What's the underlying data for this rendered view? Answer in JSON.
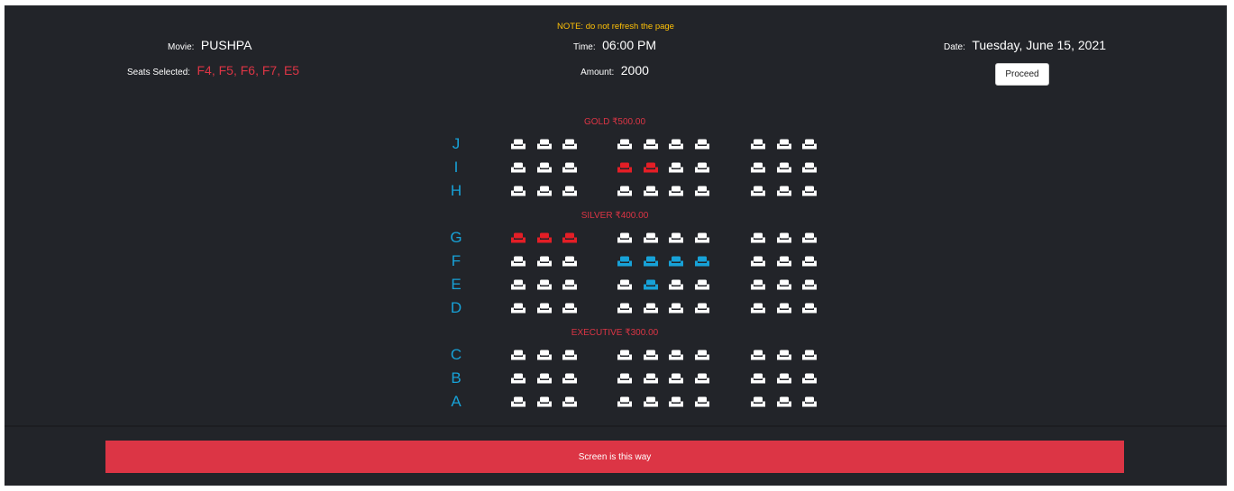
{
  "header": {
    "note": "NOTE: do not refresh the page",
    "movie": {
      "label": "Movie:",
      "value": "PUSHPA"
    },
    "seats": {
      "label": "Seats Selected:",
      "value": "F4, F5, F6, F7, E5"
    },
    "time": {
      "label": "Time:",
      "value": "06:00 PM"
    },
    "amount": {
      "label": "Amount:",
      "value": "2000"
    },
    "date": {
      "label": "Date:",
      "value": "Tuesday, June 15, 2021"
    },
    "proceed_label": "Proceed"
  },
  "colors": {
    "available": "#ffffff",
    "booked": "#e41e26",
    "selected": "#17a2d8"
  },
  "tiers": [
    {
      "label": "GOLD ₹500.00",
      "rows": [
        {
          "label": "J",
          "seats": [
            "a",
            "a",
            "a",
            "a",
            "a",
            "a",
            "a",
            "a",
            "a",
            "a"
          ]
        },
        {
          "label": "I",
          "seats": [
            "a",
            "a",
            "a",
            "b",
            "b",
            "a",
            "a",
            "a",
            "a",
            "a"
          ]
        },
        {
          "label": "H",
          "seats": [
            "a",
            "a",
            "a",
            "a",
            "a",
            "a",
            "a",
            "a",
            "a",
            "a"
          ]
        }
      ]
    },
    {
      "label": "SILVER ₹400.00",
      "rows": [
        {
          "label": "G",
          "seats": [
            "b",
            "b",
            "b",
            "a",
            "a",
            "a",
            "a",
            "a",
            "a",
            "a"
          ]
        },
        {
          "label": "F",
          "seats": [
            "a",
            "a",
            "a",
            "s",
            "s",
            "s",
            "s",
            "a",
            "a",
            "a"
          ]
        },
        {
          "label": "E",
          "seats": [
            "a",
            "a",
            "a",
            "a",
            "s",
            "a",
            "a",
            "a",
            "a",
            "a"
          ]
        },
        {
          "label": "D",
          "seats": [
            "a",
            "a",
            "a",
            "a",
            "a",
            "a",
            "a",
            "a",
            "a",
            "a"
          ]
        }
      ]
    },
    {
      "label": "EXECUTIVE ₹300.00",
      "rows": [
        {
          "label": "C",
          "seats": [
            "a",
            "a",
            "a",
            "a",
            "a",
            "a",
            "a",
            "a",
            "a",
            "a"
          ]
        },
        {
          "label": "B",
          "seats": [
            "a",
            "a",
            "a",
            "a",
            "a",
            "a",
            "a",
            "a",
            "a",
            "a"
          ]
        },
        {
          "label": "A",
          "seats": [
            "a",
            "a",
            "a",
            "a",
            "a",
            "a",
            "a",
            "a",
            "a",
            "a"
          ]
        }
      ]
    }
  ],
  "screen_label": "Screen is this way"
}
